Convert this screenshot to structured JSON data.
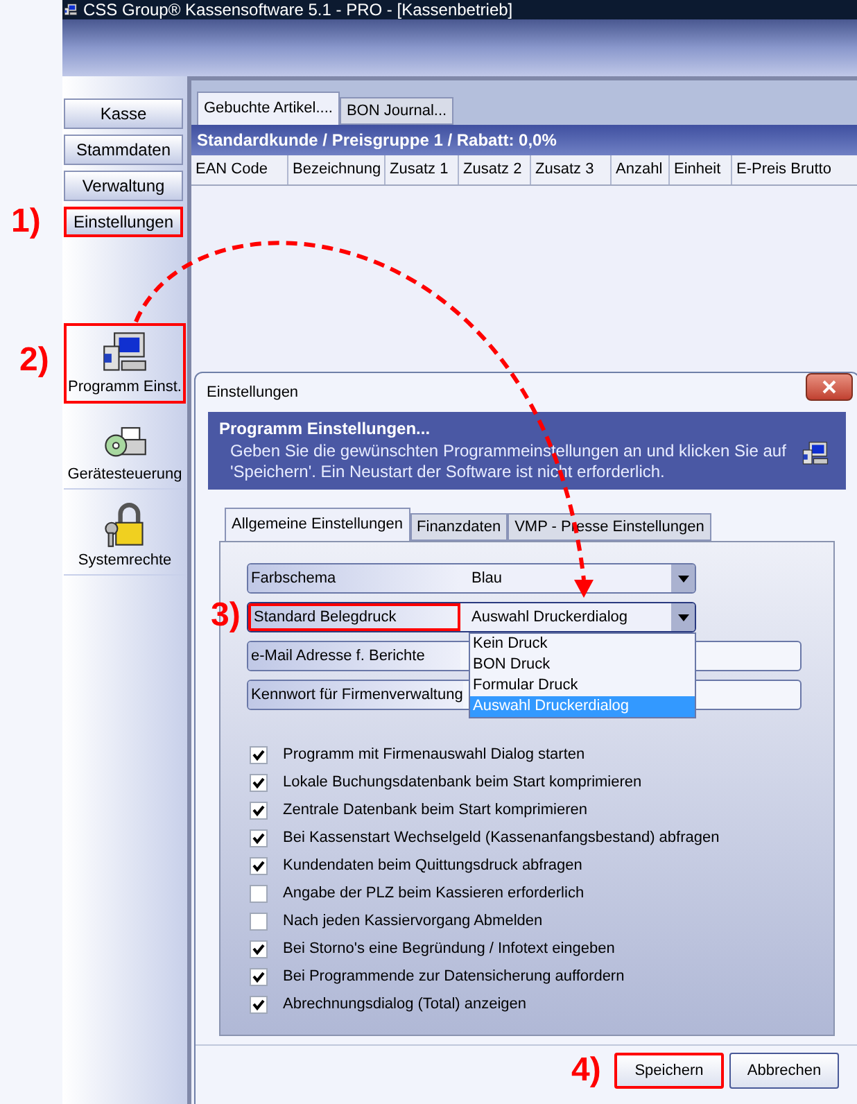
{
  "window": {
    "title": "CSS Group® Kassensoftware 5.1 - PRO - [Kassenbetrieb]"
  },
  "sidebar": {
    "buttons": [
      {
        "label": "Kasse",
        "highlighted": false
      },
      {
        "label": "Stammdaten",
        "highlighted": false
      },
      {
        "label": "Verwaltung",
        "highlighted": false
      },
      {
        "label": "Einstellungen",
        "highlighted": true
      }
    ],
    "tools": [
      {
        "label": "Programm Einst.",
        "kind": "program",
        "highlighted": true
      },
      {
        "label": "Gerätesteuerung",
        "kind": "devices",
        "highlighted": false
      },
      {
        "label": "Systemrechte",
        "kind": "rights",
        "highlighted": false
      }
    ]
  },
  "content": {
    "tabs": [
      {
        "label": "Gebuchte Artikel....",
        "selected": true
      },
      {
        "label": "BON Journal...",
        "selected": false
      }
    ],
    "header": "Standardkunde / Preisgruppe 1 / Rabatt: 0,0%",
    "columns": [
      "EAN Code",
      "Bezeichnung",
      "Zusatz 1",
      "Zusatz 2",
      "Zusatz 3",
      "Anzahl",
      "Einheit",
      "E-Preis Brutto"
    ]
  },
  "dialog": {
    "title": "Einstellungen",
    "banner": {
      "title": "Programm Einstellungen...",
      "text": "Geben Sie die gewünschten Programmeinstellungen an und klicken Sie auf 'Speichern'. Ein Neustart der Software ist nicht erforderlich."
    },
    "tabs": [
      {
        "label": "Allgemeine Einstellungen",
        "selected": true
      },
      {
        "label": "Finanzdaten",
        "selected": false
      },
      {
        "label": "VMP - Presse Einstellungen",
        "selected": false
      }
    ],
    "fields": [
      {
        "kind": "select",
        "label": "Farbschema",
        "value": "Blau",
        "highlighted": false
      },
      {
        "kind": "select",
        "label": "Standard Belegdruck",
        "value": "Auswahl Druckerdialog",
        "highlighted": true,
        "expanded": true,
        "options": [
          {
            "label": "Kein Druck",
            "selected": false
          },
          {
            "label": "BON Druck",
            "selected": false
          },
          {
            "label": "Formular Druck",
            "selected": false
          },
          {
            "label": "Auswahl Druckerdialog",
            "selected": true
          }
        ]
      },
      {
        "kind": "text",
        "label": "e-Mail Adresse f. Berichte",
        "highlighted": false
      },
      {
        "kind": "text",
        "label": "Kennwort für Firmenverwaltung",
        "highlighted": false
      }
    ],
    "checkboxes": [
      {
        "label": "Programm mit Firmenauswahl Dialog starten",
        "checked": true
      },
      {
        "label": "Lokale Buchungsdatenbank beim Start komprimieren",
        "checked": true
      },
      {
        "label": "Zentrale Datenbank beim Start komprimieren",
        "checked": true
      },
      {
        "label": "Bei Kassenstart Wechselgeld (Kassenanfangsbestand) abfragen",
        "checked": true
      },
      {
        "label": "Kundendaten beim Quittungsdruck abfragen",
        "checked": true
      },
      {
        "label": "Angabe der PLZ beim Kassieren erforderlich",
        "checked": false
      },
      {
        "label": "Nach jeden Kassiervorgang Abmelden",
        "checked": false
      },
      {
        "label": "Bei Storno's eine Begründung / Infotext eingeben",
        "checked": true
      },
      {
        "label": "Bei Programmende zur Datensicherung auffordern",
        "checked": true
      },
      {
        "label": "Abrechnungsdialog (Total) anzeigen",
        "checked": true
      }
    ],
    "buttons": [
      {
        "label": "Speichern",
        "highlighted": true
      },
      {
        "label": "Abbrechen",
        "highlighted": false
      }
    ]
  },
  "callouts": [
    {
      "label": "1)"
    },
    {
      "label": "2)"
    },
    {
      "label": "3)"
    },
    {
      "label": "4)"
    }
  ]
}
